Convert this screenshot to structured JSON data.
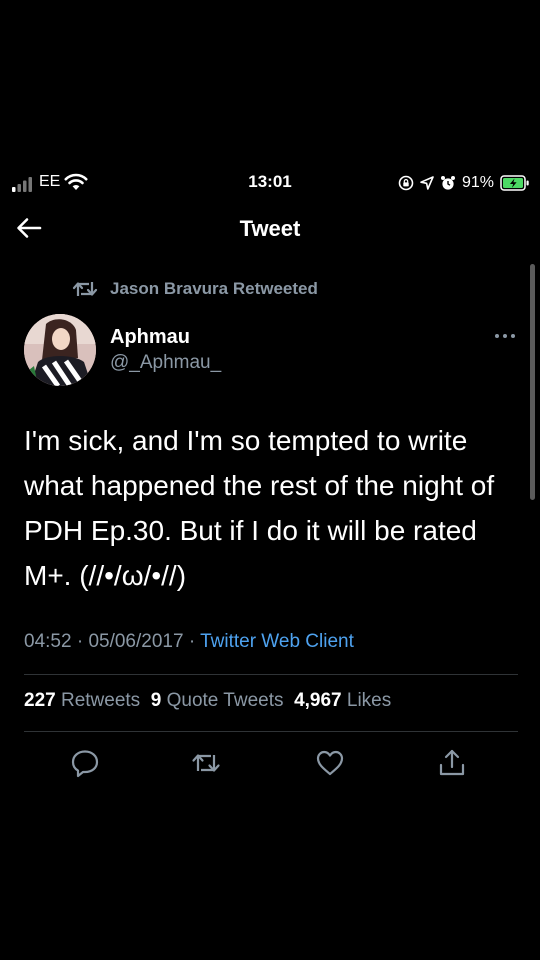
{
  "status_bar": {
    "carrier": "EE",
    "time": "13:01",
    "battery_percent": "91%"
  },
  "nav": {
    "title": "Tweet"
  },
  "tweet": {
    "retweeted_by": "Jason Bravura Retweeted",
    "author_name": "Aphmau",
    "author_handle": "@_Aphmau_",
    "text": "I'm sick, and I'm so tempted to write what happened the rest of the night of PDH Ep.30. But if I do it will be rated M+. (//•/ω/•//)",
    "time": "04:52",
    "date": "05/06/2017",
    "separator": "·",
    "client": "Twitter Web Client",
    "stats": {
      "retweets_count": "227",
      "retweets_label": "Retweets",
      "quote_count": "9",
      "quote_label": "Quote Tweets",
      "likes_count": "4,967",
      "likes_label": "Likes"
    }
  },
  "colors": {
    "background": "#000000",
    "secondary_text": "#8b98a5",
    "link": "#4ea2ef",
    "divider": "#2f3336",
    "battery_green": "#4cd964"
  },
  "icons": [
    "signal-icon",
    "wifi-icon",
    "screen-lock-icon",
    "location-icon",
    "alarm-icon",
    "battery-icon",
    "back-arrow-icon",
    "retweet-icon",
    "more-icon",
    "reply-icon",
    "like-icon",
    "share-icon"
  ]
}
